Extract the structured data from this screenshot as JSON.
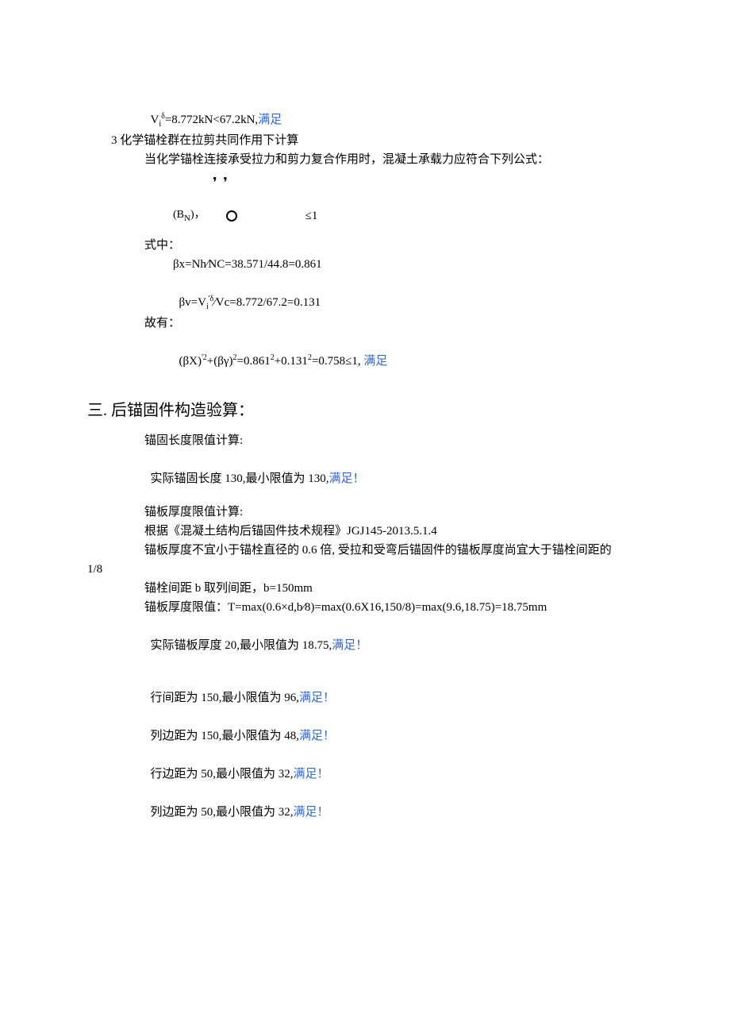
{
  "intro": {
    "l1_a": "V",
    "l1_sub1": "i",
    "l1_sup1": "δ",
    "l1_b": "=8.772kN<67.2kN,",
    "l1_ok": "满足",
    "l2": "3 化学锚栓群在拉剪共同作用下计算",
    "l3": "当化学锚栓连接承受拉力和剪力复合作用时，混凝土承载力应符合下列公式：",
    "sym_quotes": "❜❜",
    "sym_bn_a": "(B",
    "sym_bn_b": "N",
    "sym_bn_c": ")，",
    "sym_ineq": "≤1",
    "l4": "式中：",
    "l5": "βx=Nh∕NC=38.571/44.8=0.861",
    "l6_a": "βv=V",
    "l6_sub": "i",
    "l6_sup": "'δ",
    "l6_b": "∕Vc=8.772/67.2=0.131",
    "l7": "故有：",
    "l8_a": "(βX)",
    "l8_sup1": "'2",
    "l8_b": "+(βγ)",
    "l8_sup2": "2",
    "l8_c": "=0.861",
    "l8_sup3": "2",
    "l8_d": "+0.131",
    "l8_sup4": "2",
    "l8_e": "=0.758≤1, ",
    "l8_ok": "满足"
  },
  "sect_title": "三. 后锚固件构造验算：",
  "s": {
    "l1": "锚固长度限值计算:",
    "l2_a": "实际锚固长度 130,最小限值为 130,",
    "l2_ok": "满足！",
    "l3": "锚板厚度限值计算:",
    "l4": "根据《混凝土结构后锚固件技术规程》JGJ145-2013.5.1.4",
    "l5": "锚板厚度不宜小于锚栓直径的 0.6 倍, 受拉和受弯后锚固件的锚板厚度尚宜大于锚栓间距的",
    "l5b": "1/8",
    "l6": "锚栓间距 b 取列间距，b=150mm",
    "l7": "锚板厚度限值：T=max(0.6×d,b∕8)=max(0.6X16,150/8)=max(9.6,18.75)=18.75mm",
    "l8_a": "实际锚板厚度 20,最小限值为 18.75,",
    "l8_ok": "满足！",
    "l9_a": "行间距为 150,最小限值为 96,",
    "l9_ok": "满足！",
    "l10_a": "列边距为 150,最小限值为 48,",
    "l10_ok": "满足！",
    "l11_a": "行边距为 50,最小限值为 32,",
    "l11_ok": "满足！",
    "l12_a": "列边距为 50,最小限值为 32,",
    "l12_ok": "满足！"
  }
}
